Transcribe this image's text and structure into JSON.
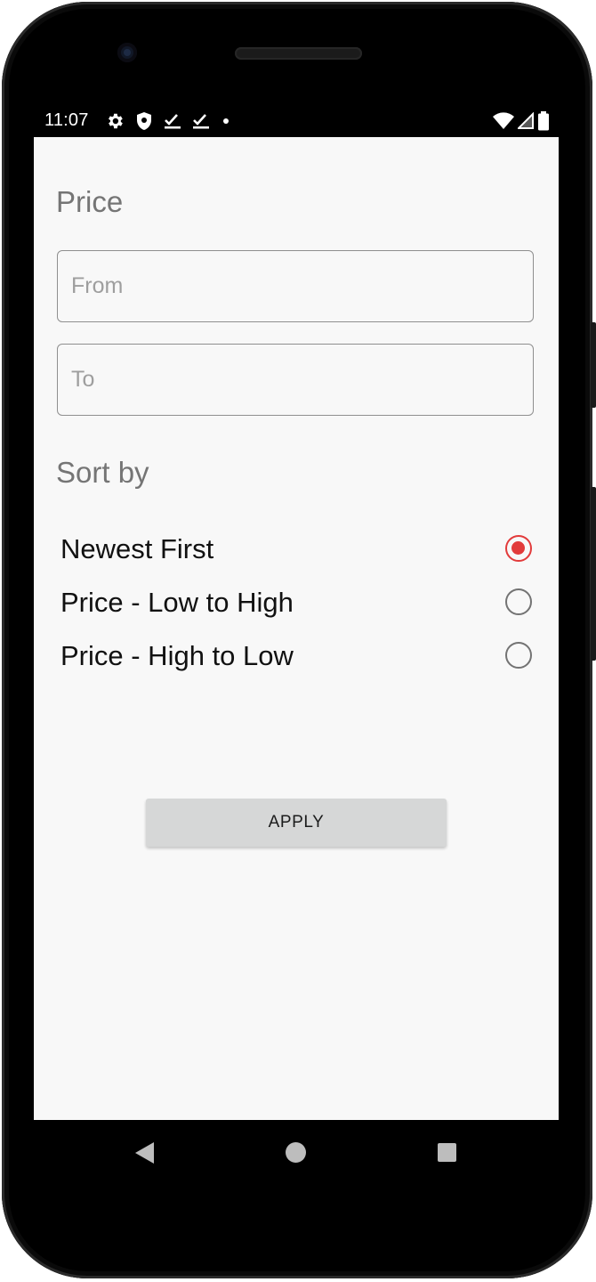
{
  "status_bar": {
    "time": "11:07",
    "left_icons": [
      "gear-icon",
      "shield-icon",
      "download-check-icon",
      "download-check-icon",
      "dot-icon"
    ],
    "right_icons": [
      "wifi-icon",
      "signal-icon",
      "battery-icon"
    ]
  },
  "price": {
    "title": "Price",
    "from_placeholder": "From",
    "from_value": "",
    "to_placeholder": "To",
    "to_value": ""
  },
  "sort": {
    "title": "Sort by",
    "selected_index": 0,
    "options": [
      {
        "label": "Newest First",
        "checked": true
      },
      {
        "label": "Price - Low to High",
        "checked": false
      },
      {
        "label": "Price - High to Low",
        "checked": false
      }
    ]
  },
  "apply_button": {
    "label": "APPLY"
  },
  "navigation": {
    "back_icon": "back-icon",
    "home_icon": "home-icon",
    "recents_icon": "recents-icon"
  },
  "colors": {
    "accent": "#e23b3b",
    "background": "#f8f8f8",
    "button": "#d6d7d7"
  }
}
